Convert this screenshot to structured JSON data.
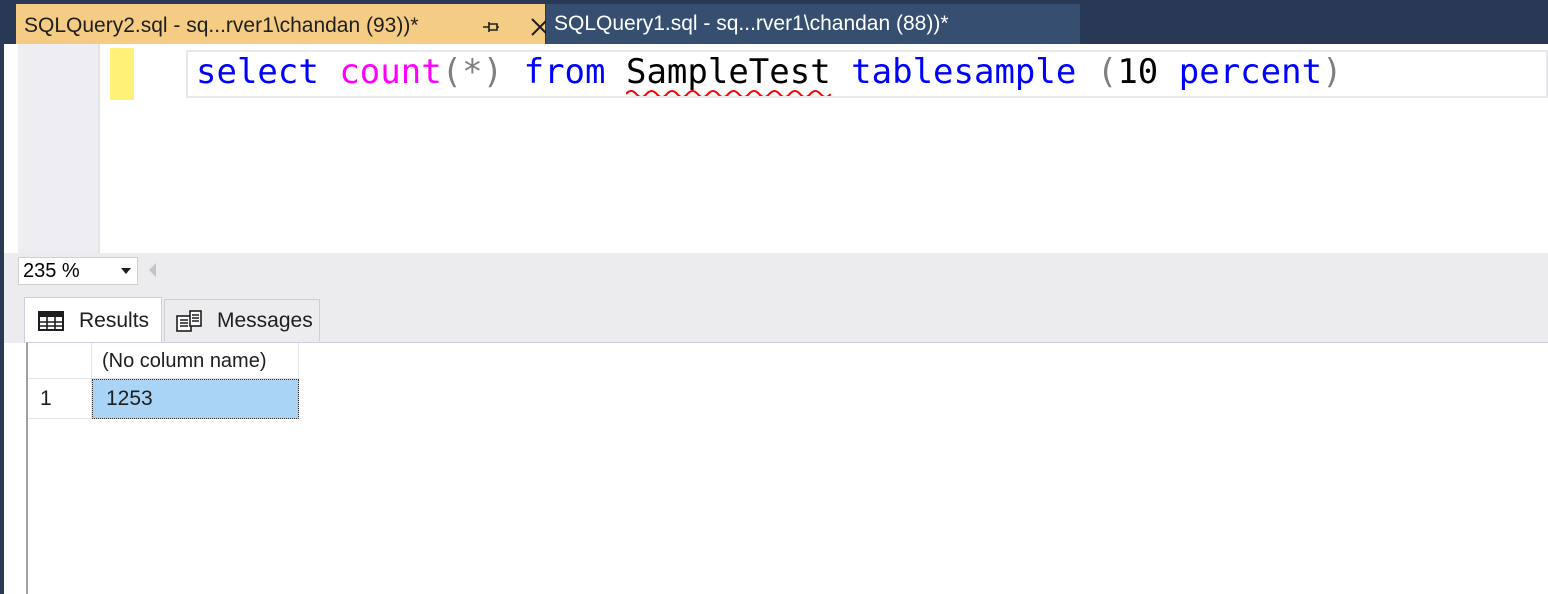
{
  "tabs": [
    {
      "label": "SQLQuery2.sql - sq...rver1\\chandan (93))*",
      "active": true
    },
    {
      "label": "SQLQuery1.sql - sq...rver1\\chandan (88))*",
      "active": false
    }
  ],
  "editor": {
    "tokens": {
      "select": "select",
      "count": "count",
      "open_paren": "(",
      "star": "*",
      "close_paren": ")",
      "from": "from",
      "table": "SampleTest",
      "tablesample": "tablesample",
      "open_paren2": "(",
      "number": "10",
      "percent": "percent",
      "close_paren2": ")"
    }
  },
  "zoom": {
    "value": "235 %"
  },
  "results": {
    "tabs": [
      {
        "label": "Results",
        "icon": "grid-icon"
      },
      {
        "label": "Messages",
        "icon": "messages-icon"
      }
    ],
    "columns": [
      "(No column name)"
    ],
    "rows": [
      {
        "row_number": "1",
        "cells": [
          "1253"
        ]
      }
    ]
  },
  "colors": {
    "tab_strip": "#293955",
    "active_tab": "#f5cc84",
    "keyword": "#0000ff",
    "function": "#ff00ff",
    "selected_cell": "#aad4f5"
  }
}
